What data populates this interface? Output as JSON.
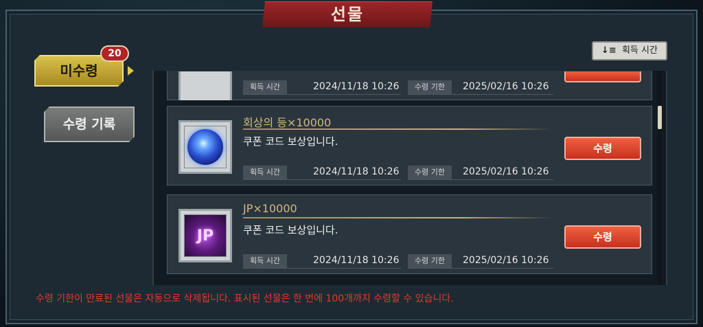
{
  "title": "선물",
  "sort_button": {
    "icon": "sort-icon",
    "label": "획득 시간"
  },
  "tabs": {
    "unclaimed": {
      "label": "미수령",
      "badge": "20"
    },
    "history": {
      "label": "수령 기록"
    }
  },
  "items": [
    {
      "name": "",
      "description": "",
      "acquired_label": "획득 시간",
      "acquired_value": "2024/11/18 10:26",
      "expiry_label": "수령 기한",
      "expiry_value": "2025/02/16 10:26",
      "claim_label": ""
    },
    {
      "name": "회상의 등×10000",
      "description": "쿠폰 코드 보상입니다.",
      "acquired_label": "획득 시간",
      "acquired_value": "2024/11/18 10:26",
      "expiry_label": "수령 기한",
      "expiry_value": "2025/02/16 10:26",
      "claim_label": "수령",
      "icon": "blue-orb-icon"
    },
    {
      "name": "JP×10000",
      "description": "쿠폰 코드 보상입니다.",
      "acquired_label": "획득 시간",
      "acquired_value": "2024/11/18 10:26",
      "expiry_label": "수령 기한",
      "expiry_value": "2025/02/16 10:26",
      "claim_label": "수령",
      "icon": "jp-icon",
      "icon_glyph": "JP"
    }
  ],
  "footer_note": "수령 기한이 만료된 선물은 자동으로 삭제됩니다. 표시된 선물은 한 번에 100개까지 수령할 수 있습니다.",
  "colors": {
    "accent_red": "#c7301e",
    "tab_gold": "#d9c14b",
    "footer_red": "#e23b2c"
  }
}
